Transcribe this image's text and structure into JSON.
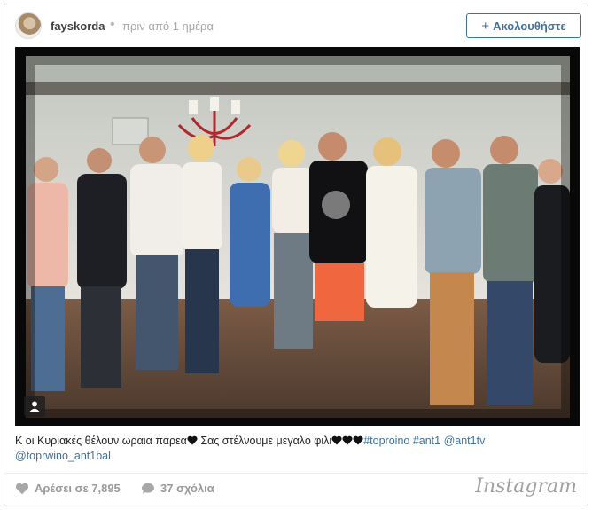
{
  "header": {
    "username": "fayskorda",
    "separator": "•",
    "timestamp": "πριν από 1 ημέρα",
    "follow_label": "Ακολουθήστε"
  },
  "caption": {
    "text_1": "Κ οι Κυριακές θέλουν ωραια παρεα",
    "text_2": " Σας στέλνουμε μεγαλο φιλι",
    "hashtags": "#toproino #ant1",
    "mention_1": "@ant1tv",
    "mention_2": "@toprwino_ant1bal"
  },
  "footer": {
    "likes": "Αρέσει σε 7,895",
    "comments": "37 σχόλια",
    "brand": "Instagram"
  },
  "colors": {
    "accent": "#3f729b",
    "muted": "#9a9a9a"
  },
  "icons": [
    "avatar",
    "plus-icon",
    "user-tag-icon",
    "heart-icon",
    "comment-icon"
  ]
}
